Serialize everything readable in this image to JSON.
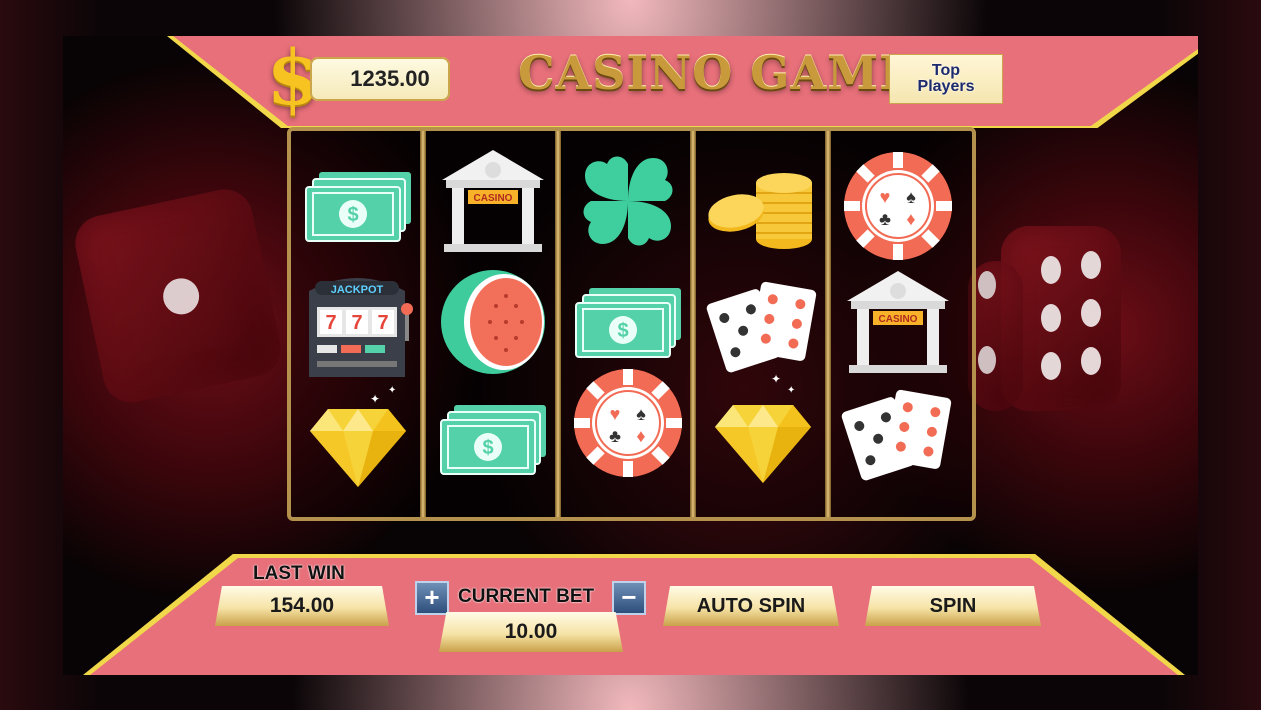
{
  "header": {
    "balance": "1235.00",
    "title": "CASINO GAME",
    "top_players_label": "Top Players"
  },
  "reels": [
    [
      "cash-stack",
      "jackpot-slot-machine",
      "diamond"
    ],
    [
      "casino-building",
      "watermelon",
      "cash-stack"
    ],
    [
      "four-leaf-clover",
      "cash-stack",
      "poker-chip"
    ],
    [
      "gold-coins",
      "playing-cards",
      "diamond"
    ],
    [
      "poker-chip",
      "casino-building",
      "playing-cards"
    ]
  ],
  "symbol_text": {
    "casino_sign": "CASINO",
    "jackpot_sign": "JACKPOT",
    "slot_digits": "777"
  },
  "controls": {
    "last_win_label": "LAST WIN",
    "last_win_value": "154.00",
    "current_bet_label": "CURRENT BET",
    "current_bet_value": "10.00",
    "plus_label": "+",
    "minus_label": "−",
    "auto_spin_label": "AUTO SPIN",
    "spin_label": "SPIN"
  },
  "colors": {
    "banner": "#e8707a",
    "accent_gold": "#f0d84a",
    "cash_green": "#55d1a9",
    "chip_red": "#f26b55",
    "diamond_yellow": "#f7d33a"
  }
}
